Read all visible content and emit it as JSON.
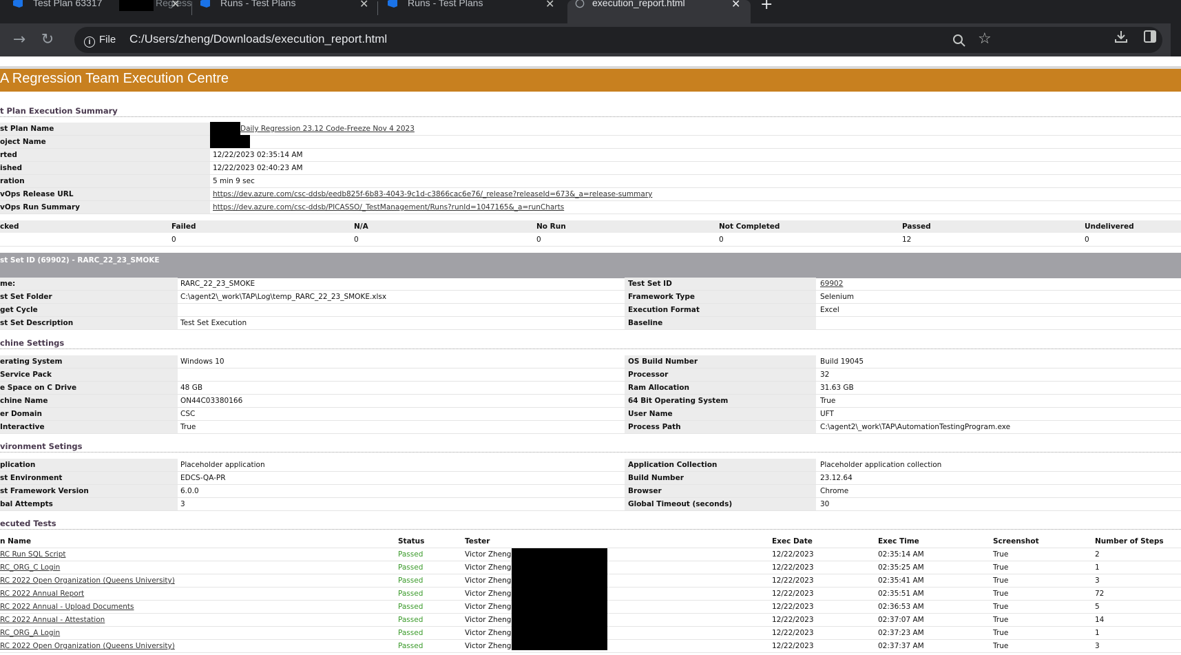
{
  "browser": {
    "tabs": [
      {
        "label": "Test Plan 63317",
        "label2": "Regress"
      },
      {
        "label": "Runs - Test Plans"
      },
      {
        "label": "Runs - Test Plans"
      },
      {
        "label": "execution_report.html"
      }
    ],
    "new_tab": "+",
    "file_chip": "File",
    "url": "C:/Users/zheng/Downloads/execution_report.html"
  },
  "banner": {
    "title": "A Regression Team Execution Centre"
  },
  "summary": {
    "title": "t Plan Execution Summary",
    "rows": [
      {
        "label": "st Plan Name",
        "value": "Daily Regression 23.12 Code-Freeze Nov 4 2023",
        "link": true
      },
      {
        "label": "oject Name",
        "value": ""
      },
      {
        "label": "rted",
        "value": "12/22/2023 02:35:14 AM"
      },
      {
        "label": "ished",
        "value": "12/22/2023 02:40:23 AM"
      },
      {
        "label": "ration",
        "value": "5 min 9 sec"
      },
      {
        "label": "vOps Release URL",
        "value": "https://dev.azure.com/csc-ddsb/eedb825f-6b83-4043-9c1d-c3866cac6e76/_release?releaseId=673&_a=release-summary",
        "link": true
      },
      {
        "label": "vOps Run Summary",
        "value": "https://dev.azure.com/csc-ddsb/PICASSO/_TestManagement/Runs?runId=1047165&_a=runCharts",
        "link": true
      }
    ]
  },
  "counts": {
    "headers": [
      "cked",
      "Failed",
      "N/A",
      "No Run",
      "Not Completed",
      "Passed",
      "Undelivered"
    ],
    "values": [
      "",
      "0",
      "0",
      "0",
      "0",
      "12",
      "0"
    ]
  },
  "testset": {
    "bar_title": "st Set ID (69902) - RARC_22_23_SMOKE",
    "rows": [
      {
        "l1": "me:",
        "v1": "RARC_22_23_SMOKE",
        "l2": "Test Set ID",
        "v2": "69902",
        "link2": true
      },
      {
        "l1": "st Set Folder",
        "v1": "C:\\agent2\\_work\\TAP\\Log\\temp_RARC_22_23_SMOKE.xlsx",
        "l2": "Framework Type",
        "v2": "Selenium"
      },
      {
        "l1": "get Cycle",
        "v1": "",
        "l2": "Execution Format",
        "v2": "Excel"
      },
      {
        "l1": "st Set Description",
        "v1": "Test Set Execution",
        "l2": "Baseline",
        "v2": ""
      }
    ]
  },
  "machine": {
    "title": "chine Settings",
    "rows": [
      {
        "l1": "erating System",
        "v1": "Windows 10",
        "l2": "OS Build Number",
        "v2": "Build 19045"
      },
      {
        "l1": " Service Pack",
        "v1": "",
        "l2": "Processor",
        "v2": "32"
      },
      {
        "l1": "e Space on C Drive",
        "v1": "48 GB",
        "l2": "Ram Allocation",
        "v2": "31.63 GB"
      },
      {
        "l1": "chine Name",
        "v1": "ON44C03380166",
        "l2": "64 Bit Operating System",
        "v2": "True"
      },
      {
        "l1": "er Domain",
        "v1": "CSC",
        "l2": "User Name",
        "v2": "UFT"
      },
      {
        "l1": "Interactive",
        "v1": "True",
        "l2": "Process Path",
        "v2": "C:\\agent2\\_work\\TAP\\AutomationTestingProgram.exe"
      }
    ]
  },
  "environment": {
    "title": "vironment Setings",
    "rows": [
      {
        "l1": "plication",
        "v1": "Placeholder application",
        "l2": "Application Collection",
        "v2": "Placeholder application collection"
      },
      {
        "l1": "st Environment",
        "v1": "EDCS-QA-PR",
        "l2": "Build Number",
        "v2": "23.12.64"
      },
      {
        "l1": "st Framework Version",
        "v1": "6.0.0",
        "l2": "Browser",
        "v2": "Chrome"
      },
      {
        "l1": "bal Attempts",
        "v1": "3",
        "l2": "Global Timeout (seconds)",
        "v2": "30"
      }
    ]
  },
  "executed": {
    "title": "ecuted Tests",
    "headers": [
      "n Name",
      "Status",
      "Tester",
      "Exec Date",
      "Exec Time",
      "Screenshot",
      "Number of Steps"
    ],
    "rows": [
      [
        "RC Run SQL Script",
        "Passed",
        "Victor Zheng",
        "12/22/2023",
        "02:35:14 AM",
        "True",
        "2"
      ],
      [
        "RC_ORG_C Login",
        "Passed",
        "Victor Zheng",
        "12/22/2023",
        "02:35:25 AM",
        "True",
        "1"
      ],
      [
        "RC 2022 Open Organization (Queens University)",
        "Passed",
        "Victor Zheng",
        "12/22/2023",
        "02:35:41 AM",
        "True",
        "3"
      ],
      [
        "RC 2022 Annual Report",
        "Passed",
        "Victor Zheng",
        "12/22/2023",
        "02:35:51 AM",
        "True",
        "72"
      ],
      [
        "RC 2022 Annual - Upload Documents",
        "Passed",
        "Victor Zheng",
        "12/22/2023",
        "02:36:53 AM",
        "True",
        "5"
      ],
      [
        "RC 2022 Annual - Attestation",
        "Passed",
        "Victor Zheng",
        "12/22/2023",
        "02:37:07 AM",
        "True",
        "14"
      ],
      [
        "RC_ORG_A Login",
        "Passed",
        "Victor Zheng",
        "12/22/2023",
        "02:37:23 AM",
        "True",
        "1"
      ],
      [
        "RC 2022 Open Organization (Queens University)",
        "Passed",
        "Victor Zheng",
        "12/22/2023",
        "02:37:37 AM",
        "True",
        "3"
      ]
    ]
  }
}
